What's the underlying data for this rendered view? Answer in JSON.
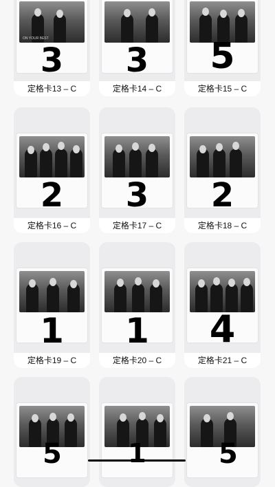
{
  "cards": [
    {
      "label": "定格卡13 – C",
      "tally": "3"
    },
    {
      "label": "定格卡14 – C",
      "tally": "3"
    },
    {
      "label": "定格卡15 – C",
      "tally": "5"
    },
    {
      "label": "定格卡16 – C",
      "tally": "2"
    },
    {
      "label": "定格卡17 – C",
      "tally": "3"
    },
    {
      "label": "定格卡18 – C",
      "tally": "2"
    },
    {
      "label": "定格卡19 – C",
      "tally": "1"
    },
    {
      "label": "定格卡20 – C",
      "tally": "1"
    },
    {
      "label": "定格卡21 – C",
      "tally": "4"
    },
    {
      "label": "",
      "tally": "5"
    },
    {
      "label": "",
      "tally": "1"
    },
    {
      "label": "",
      "tally": "5"
    }
  ],
  "accent": {
    "background": "#f7f7f8",
    "card": "#ececee",
    "label_bg": "#ffffff"
  }
}
